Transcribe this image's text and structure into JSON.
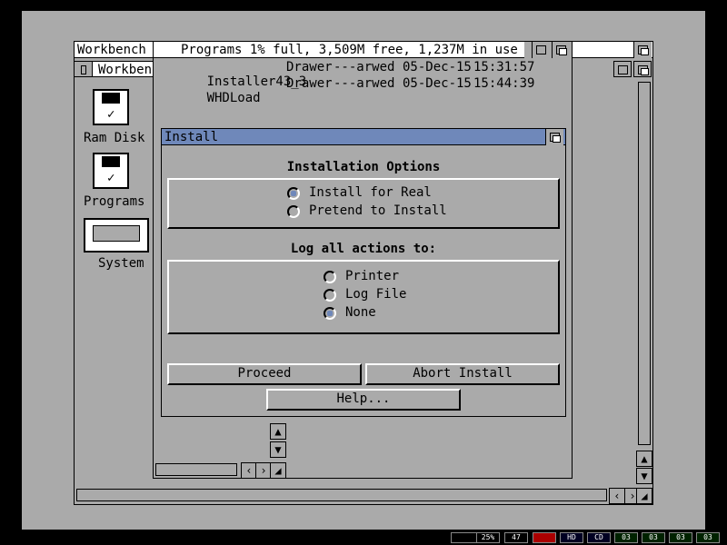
{
  "workbench": {
    "title": "Workbench S"
  },
  "programs_window": {
    "title": "Programs  1% full, 3,509M free, 1,237M in use",
    "rows": [
      {
        "name": "Installer43_3",
        "type": "Drawer",
        "prot": "---arwed",
        "date": "05-Dec-15",
        "time": "15:31:57"
      },
      {
        "name": "WHDLoad",
        "type": "Drawer",
        "prot": "---arwed",
        "date": "05-Dec-15",
        "time": "15:44:39"
      }
    ]
  },
  "workbench_drawer": {
    "title": "Workbench"
  },
  "desktop_icons": [
    {
      "label": "Ram Disk"
    },
    {
      "label": "Programs"
    },
    {
      "label": "System"
    }
  ],
  "install_dialog": {
    "title": "Install",
    "section1_title": "Installation Options",
    "options1": [
      {
        "label": "Install for Real",
        "selected": true
      },
      {
        "label": "Pretend to Install",
        "selected": false
      }
    ],
    "section2_title": "Log all actions to:",
    "options2": [
      {
        "label": "Printer",
        "selected": false
      },
      {
        "label": "Log File",
        "selected": false
      },
      {
        "label": "None",
        "selected": true
      }
    ],
    "proceed_label": "Proceed",
    "abort_label": "Abort Install",
    "help_label": "Help..."
  },
  "status_strip": [
    "",
    "25%",
    "47",
    "",
    "HD",
    "CD",
    "03",
    "03",
    "03",
    "03"
  ],
  "colors": {
    "screen": "#aaaaaa",
    "accent": "#6f88ba",
    "status_red": "#aa0000"
  }
}
